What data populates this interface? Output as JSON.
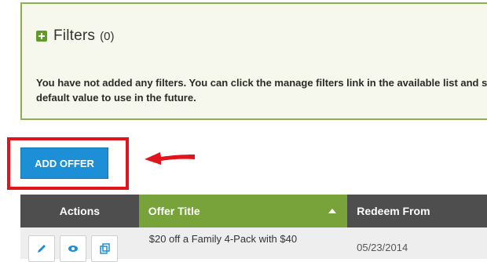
{
  "filters": {
    "title": "Filters",
    "count": "(0)",
    "message": "You have not added any filters. You can click the manage filters link in the available list and set a default value to use in the future."
  },
  "toolbar": {
    "add_offer_label": "ADD OFFER"
  },
  "table": {
    "columns": [
      "Actions",
      "Offer Title",
      "Redeem From"
    ],
    "rows": [
      {
        "offer_title": "$20 off a Family 4-Pack with $40",
        "redeem_from": "05/23/2014"
      }
    ]
  },
  "colors": {
    "panel_border": "#8bb04d",
    "panel_background": "#f7f8ed",
    "button": "#1d8fd6",
    "highlight": "#e0141a",
    "header_dark": "#4e4e4e",
    "header_green": "#77a33a"
  },
  "icons": [
    "plus-icon",
    "arrow-icon",
    "sort-asc-icon",
    "edit-icon",
    "view-icon",
    "copy-icon"
  ]
}
